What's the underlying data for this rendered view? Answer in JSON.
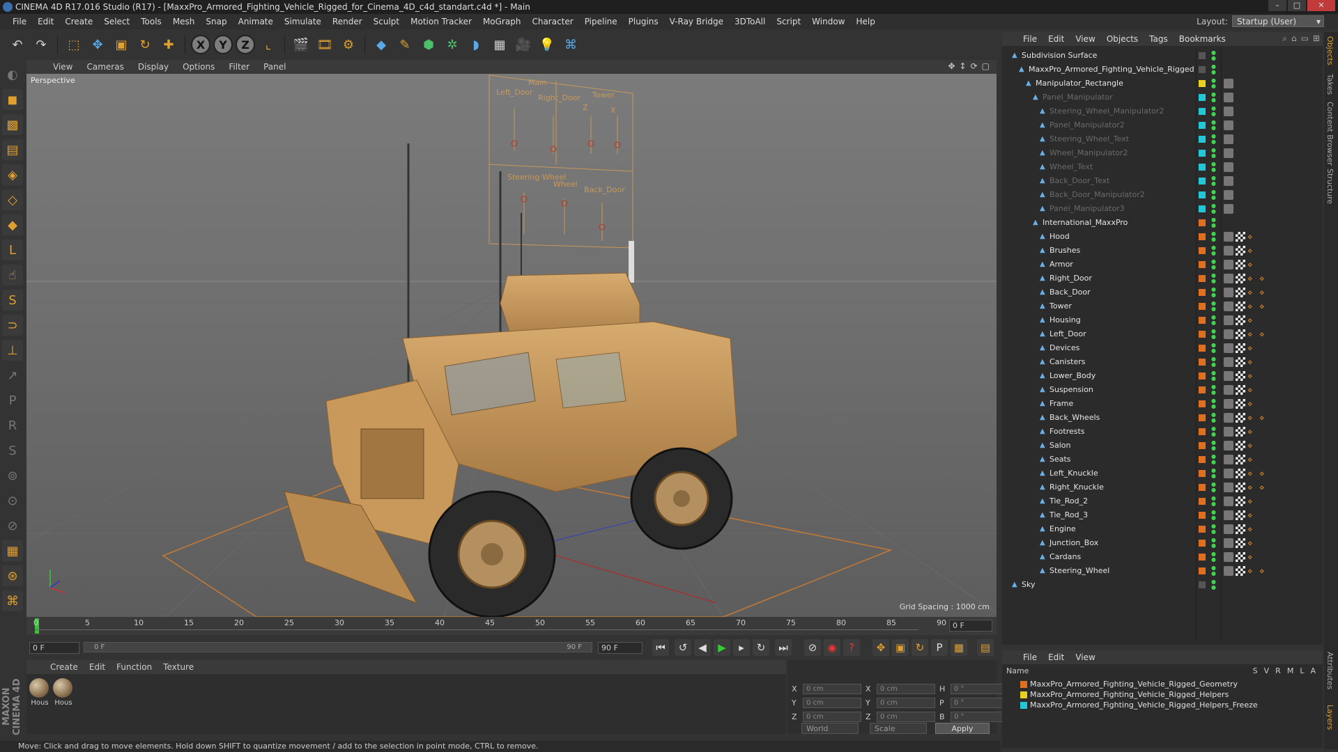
{
  "window": {
    "title": "CINEMA 4D R17.016 Studio (R17) - [MaxxPro_Armored_Fighting_Vehicle_Rigged_for_Cinema_4D_c4d_standart.c4d *] - Main"
  },
  "menu": [
    "File",
    "Edit",
    "Create",
    "Select",
    "Tools",
    "Mesh",
    "Snap",
    "Animate",
    "Simulate",
    "Render",
    "Sculpt",
    "Motion Tracker",
    "MoGraph",
    "Character",
    "Pipeline",
    "Plugins",
    "V-Ray Bridge",
    "3DToAll",
    "Script",
    "Window",
    "Help"
  ],
  "layout": {
    "label": "Layout:",
    "value": "Startup (User)"
  },
  "viewport": {
    "menu": [
      "View",
      "Cameras",
      "Display",
      "Options",
      "Filter",
      "Panel"
    ],
    "label": "Perspective",
    "grid_spacing": "Grid Spacing : 1000 cm",
    "panel_labels": {
      "title": "Main",
      "left_door": "Left_Door",
      "right_door": "Right_Door",
      "tower": "Tower",
      "z": "Z",
      "x": "X",
      "steering": "Steering Wheel",
      "wheel": "Wheel",
      "back_door": "Back_Door"
    }
  },
  "timeline": {
    "ticks": [
      "0",
      "5",
      "10",
      "15",
      "20",
      "25",
      "30",
      "35",
      "40",
      "45",
      "50",
      "55",
      "60",
      "65",
      "70",
      "75",
      "80",
      "85",
      "90"
    ],
    "frame_field": "0 F",
    "start_field": "0 F",
    "slider_start": "0 F",
    "slider_end": "90 F",
    "end_field": "90 F"
  },
  "material_manager": {
    "menu": [
      "Create",
      "Edit",
      "Function",
      "Texture"
    ],
    "materials": [
      "Hous",
      "Hous"
    ]
  },
  "coordinates": {
    "rows": [
      {
        "a": "X",
        "av": "0 cm",
        "b": "X",
        "bv": "0 cm",
        "c": "H",
        "cv": "0 °"
      },
      {
        "a": "Y",
        "av": "0 cm",
        "b": "Y",
        "bv": "0 cm",
        "c": "P",
        "cv": "0 °"
      },
      {
        "a": "Z",
        "av": "0 cm",
        "b": "Z",
        "bv": "0 cm",
        "c": "B",
        "cv": "0 °"
      }
    ],
    "mode1": "World",
    "mode2": "Scale",
    "apply": "Apply"
  },
  "status": "Move: Click and drag to move elements. Hold down SHIFT to quantize movement / add to the selection in point mode, CTRL to remove.",
  "object_manager": {
    "menu": [
      "File",
      "Edit",
      "View",
      "Objects",
      "Tags",
      "Bookmarks"
    ],
    "objects": [
      {
        "name": "Subdivision Surface",
        "dim": false,
        "layer": "",
        "tags": 0
      },
      {
        "name": "MaxxPro_Armored_Fighting_Vehicle_Rigged",
        "dim": false,
        "layer": "",
        "tags": 0
      },
      {
        "name": "Manipulator_Rectangle",
        "dim": false,
        "layer": "#e8d020",
        "tags": 1
      },
      {
        "name": "Panel_Manipulator",
        "dim": true,
        "layer": "#22c8d8",
        "tags": 1
      },
      {
        "name": "Steering_Wheel_Manipulator2",
        "dim": true,
        "layer": "#22c8d8",
        "tags": 1
      },
      {
        "name": "Panel_Manipulator2",
        "dim": true,
        "layer": "#22c8d8",
        "tags": 1
      },
      {
        "name": "Steering_Wheel_Text",
        "dim": true,
        "layer": "#22c8d8",
        "tags": 1
      },
      {
        "name": "Wheel_Manipulator2",
        "dim": true,
        "layer": "#22c8d8",
        "tags": 1
      },
      {
        "name": "Wheel_Text",
        "dim": true,
        "layer": "#22c8d8",
        "tags": 1
      },
      {
        "name": "Back_Door_Text",
        "dim": true,
        "layer": "#22c8d8",
        "tags": 1
      },
      {
        "name": "Back_Door_Manipulator2",
        "dim": true,
        "layer": "#22c8d8",
        "tags": 1
      },
      {
        "name": "Panel_Manipulator3",
        "dim": true,
        "layer": "#22c8d8",
        "tags": 1
      },
      {
        "name": "International_MaxxPro",
        "dim": false,
        "layer": "#e07020",
        "tags": 0
      },
      {
        "name": "Hood",
        "dim": false,
        "layer": "#e07020",
        "tags": 3
      },
      {
        "name": "Brushes",
        "dim": false,
        "layer": "#e07020",
        "tags": 3
      },
      {
        "name": "Armor",
        "dim": false,
        "layer": "#e07020",
        "tags": 3
      },
      {
        "name": "Right_Door",
        "dim": false,
        "layer": "#e07020",
        "tags": 4
      },
      {
        "name": "Back_Door",
        "dim": false,
        "layer": "#e07020",
        "tags": 4
      },
      {
        "name": "Tower",
        "dim": false,
        "layer": "#e07020",
        "tags": 4
      },
      {
        "name": "Housing",
        "dim": false,
        "layer": "#e07020",
        "tags": 3
      },
      {
        "name": "Left_Door",
        "dim": false,
        "layer": "#e07020",
        "tags": 4
      },
      {
        "name": "Devices",
        "dim": false,
        "layer": "#e07020",
        "tags": 3
      },
      {
        "name": "Canisters",
        "dim": false,
        "layer": "#e07020",
        "tags": 3
      },
      {
        "name": "Lower_Body",
        "dim": false,
        "layer": "#e07020",
        "tags": 3
      },
      {
        "name": "Suspension",
        "dim": false,
        "layer": "#e07020",
        "tags": 3
      },
      {
        "name": "Frame",
        "dim": false,
        "layer": "#e07020",
        "tags": 3
      },
      {
        "name": "Back_Wheels",
        "dim": false,
        "layer": "#e07020",
        "tags": 4
      },
      {
        "name": "Footrests",
        "dim": false,
        "layer": "#e07020",
        "tags": 3
      },
      {
        "name": "Salon",
        "dim": false,
        "layer": "#e07020",
        "tags": 3
      },
      {
        "name": "Seats",
        "dim": false,
        "layer": "#e07020",
        "tags": 3
      },
      {
        "name": "Left_Knuckle",
        "dim": false,
        "layer": "#e07020",
        "tags": 4
      },
      {
        "name": "Right_Knuckle",
        "dim": false,
        "layer": "#e07020",
        "tags": 4
      },
      {
        "name": "Tie_Rod_2",
        "dim": false,
        "layer": "#e07020",
        "tags": 3
      },
      {
        "name": "Tie_Rod_3",
        "dim": false,
        "layer": "#e07020",
        "tags": 3
      },
      {
        "name": "Engine",
        "dim": false,
        "layer": "#e07020",
        "tags": 3
      },
      {
        "name": "Junction_Box",
        "dim": false,
        "layer": "#e07020",
        "tags": 3
      },
      {
        "name": "Cardans",
        "dim": false,
        "layer": "#e07020",
        "tags": 3
      },
      {
        "name": "Steering_Wheel",
        "dim": false,
        "layer": "#e07020",
        "tags": 4
      },
      {
        "name": "Sky",
        "dim": false,
        "layer": "",
        "tags": 0
      }
    ]
  },
  "layer_manager": {
    "menu": [
      "File",
      "Edit",
      "View"
    ],
    "header": "Name",
    "columns": [
      "S",
      "V",
      "R",
      "M",
      "L",
      "A"
    ],
    "layers": [
      {
        "name": "MaxxPro_Armored_Fighting_Vehicle_Rigged_Geometry",
        "color": "#e07020"
      },
      {
        "name": "MaxxPro_Armored_Fighting_Vehicle_Rigged_Helpers",
        "color": "#e8d020"
      },
      {
        "name": "MaxxPro_Armored_Fighting_Vehicle_Rigged_Helpers_Freeze",
        "color": "#22c8d8"
      }
    ]
  },
  "right_tabs": [
    "Objects",
    "Takes",
    "Content Browser",
    "Structure",
    "Attributes",
    "Layers"
  ]
}
